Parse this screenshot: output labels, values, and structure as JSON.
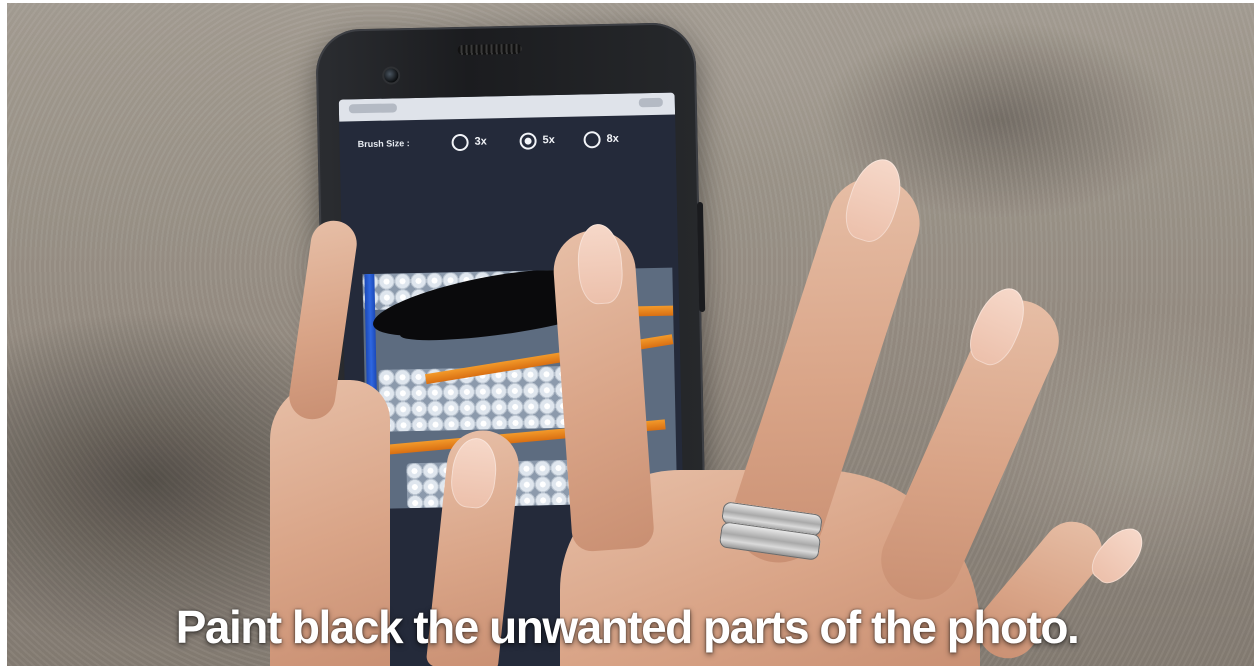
{
  "app": {
    "brush_size": {
      "label": "Brush Size :",
      "options": [
        "3x",
        "5x",
        "8x"
      ],
      "selected": "5x"
    }
  },
  "caption": {
    "text": "Paint black  the unwanted parts of the photo."
  },
  "colors": {
    "screen_background": "#242a3a",
    "paint_stroke": "#0a0a0c",
    "shelf_orange": "#f39a2a",
    "shelf_blue": "#2f67e0",
    "caption_text": "#ffffff"
  },
  "icons": {
    "radio_unselected": "radio-empty-icon",
    "radio_selected": "radio-filled-icon"
  }
}
